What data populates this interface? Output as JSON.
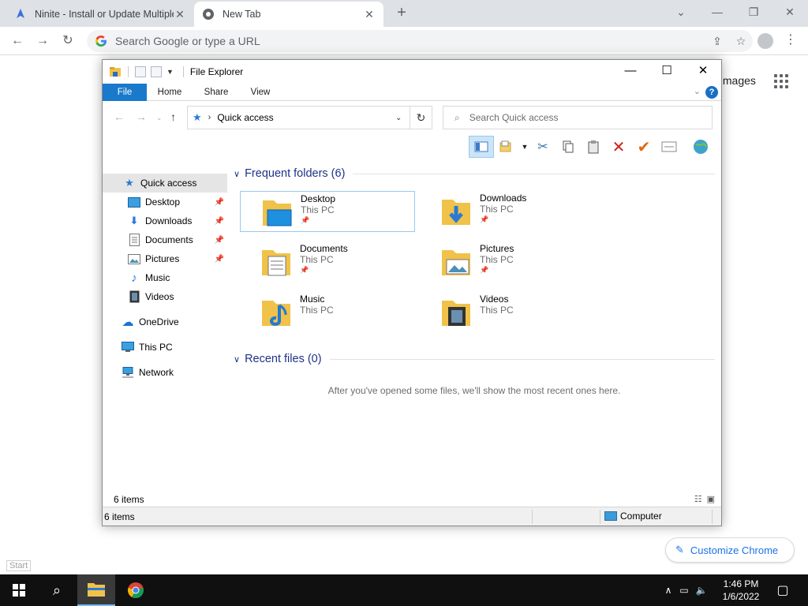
{
  "browser": {
    "tabs": [
      {
        "title": "Ninite - Install or Update Multiple Apps at Once",
        "active": false
      },
      {
        "title": "New Tab",
        "active": true
      }
    ],
    "omnibox_placeholder": "Search Google or type a URL",
    "images_link": "Images",
    "customize_label": "Customize Chrome",
    "start_label": "Start"
  },
  "explorer": {
    "title": "File Explorer",
    "ribbon_tabs": [
      "File",
      "Home",
      "Share",
      "View"
    ],
    "address_path": "Quick access",
    "search_placeholder": "Search Quick access",
    "sidebar": [
      {
        "label": "Quick access",
        "icon": "star-icon",
        "selected": true,
        "pinned": false
      },
      {
        "label": "Desktop",
        "icon": "desktop-icon",
        "pinned": true
      },
      {
        "label": "Downloads",
        "icon": "download-icon",
        "pinned": true
      },
      {
        "label": "Documents",
        "icon": "documents-icon",
        "pinned": true
      },
      {
        "label": "Pictures",
        "icon": "pictures-icon",
        "pinned": true
      },
      {
        "label": "Music",
        "icon": "music-icon",
        "pinned": false
      },
      {
        "label": "Videos",
        "icon": "videos-icon",
        "pinned": false
      },
      {
        "label": "OneDrive",
        "icon": "cloud-icon",
        "pinned": false
      },
      {
        "label": "This PC",
        "icon": "computer-icon",
        "pinned": false
      },
      {
        "label": "Network",
        "icon": "network-icon",
        "pinned": false
      }
    ],
    "frequent_header": "Frequent folders (6)",
    "folders": [
      {
        "name": "Desktop",
        "location": "This PC",
        "pinned": true
      },
      {
        "name": "Downloads",
        "location": "This PC",
        "pinned": true
      },
      {
        "name": "Documents",
        "location": "This PC",
        "pinned": true
      },
      {
        "name": "Pictures",
        "location": "This PC",
        "pinned": true
      },
      {
        "name": "Music",
        "location": "This PC",
        "pinned": false
      },
      {
        "name": "Videos",
        "location": "This PC",
        "pinned": false
      }
    ],
    "recent_header": "Recent files (0)",
    "recent_empty": "After you've opened some files, we'll show the most recent ones here.",
    "inner_status": "6 items",
    "status_items": "6 items",
    "status_computer": "Computer"
  },
  "taskbar": {
    "time": "1:46 PM",
    "date": "1/6/2022"
  },
  "colors": {
    "accent": "#1979ca",
    "section_header": "#1e3287",
    "taskbar": "#101010"
  }
}
